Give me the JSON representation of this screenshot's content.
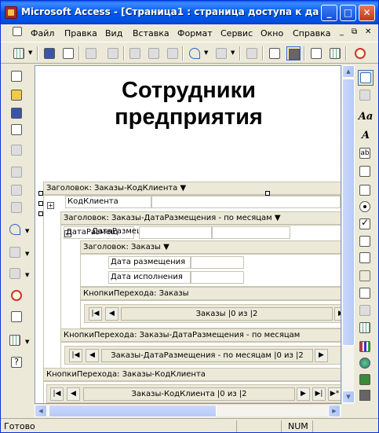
{
  "window": {
    "title": "Microsoft Access - [Страница1 : страница доступа к данн..."
  },
  "menu": [
    {
      "label": "Файл"
    },
    {
      "label": "Правка"
    },
    {
      "label": "Вид"
    },
    {
      "label": "Вставка"
    },
    {
      "label": "Формат"
    },
    {
      "label": "Сервис"
    },
    {
      "label": "Окно"
    },
    {
      "label": "Справка"
    }
  ],
  "page": {
    "title_line1": "Сотрудники",
    "title_line2": "предприятия"
  },
  "sections": {
    "header_client": "Заголовок: Заказы-КодКлиента",
    "field_client_label": "КодКлиента",
    "header_date_group": "Заголовок: Заказы-ДатаРазмещения - по месяцам",
    "overlapped_label_a": "ДатаРазмещ",
    "overlapped_label_b": "ДатаРазмещ",
    "header_orders": "Заголовок: Заказы",
    "field_date_placed": "Дата размещения",
    "field_date_done": "Дата исполнения",
    "nav_orders_header": "КнопкиПерехода: Заказы",
    "nav_orders_text": "Заказы |0 из |2",
    "nav_date_header": "КнопкиПерехода: Заказы-ДатаРазмещения - по месяцам",
    "nav_date_text": "Заказы-ДатаРазмещения - по месяцам |0 из |2",
    "nav_client_header": "КнопкиПерехода: Заказы-КодКлиента",
    "nav_client_text": "Заказы-КодКлиента |0 из |2"
  },
  "status": {
    "left": "Готово",
    "num": "NUM"
  }
}
